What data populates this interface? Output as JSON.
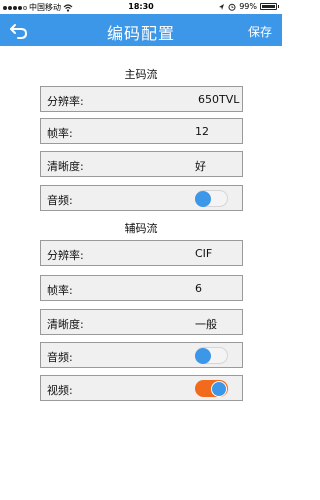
{
  "status_bar": {
    "carrier": "中国移动",
    "time": "18:30",
    "battery": "99%"
  },
  "nav": {
    "title": "编码配置",
    "save_label": "保存"
  },
  "main_stream": {
    "title": "主码流",
    "resolution": {
      "label": "分辨率:",
      "value": "650TVL"
    },
    "frame_rate": {
      "label": "帧率:",
      "value": "12"
    },
    "clarity": {
      "label": "清晰度:",
      "value": "好"
    },
    "audio": {
      "label": "音频:",
      "enabled": false
    }
  },
  "sub_stream": {
    "title": "辅码流",
    "resolution": {
      "label": "分辨率:",
      "value": "CIF"
    },
    "frame_rate": {
      "label": "帧率:",
      "value": "6"
    },
    "clarity": {
      "label": "清晰度:",
      "value": "一般"
    },
    "audio": {
      "label": "音频:",
      "enabled": false
    },
    "video": {
      "label": "视频:",
      "enabled": true
    }
  },
  "colors": {
    "accent": "#3d97e9",
    "toggle_on": "#f26a1b"
  }
}
